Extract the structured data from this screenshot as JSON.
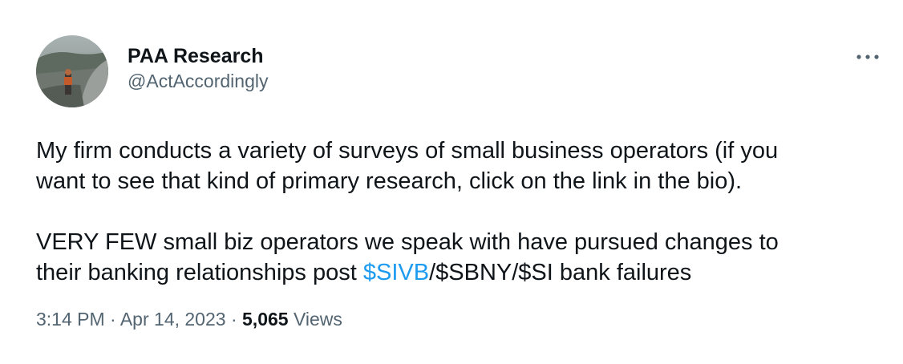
{
  "tweet": {
    "author": {
      "display_name": "PAA Research",
      "handle": "@ActAccordingly"
    },
    "more_icon": "more-horizontal-icon",
    "paragraphs": [
      {
        "line1": "My firm conducts a variety of surveys of small business operators (if you",
        "line2": "want to see that kind of primary research, click on the link in the bio)."
      },
      {
        "line1": "VERY FEW small biz operators we speak with have pursued changes to",
        "line2_prefix": "their banking relationships post ",
        "cashtag": "$SIVB",
        "line2_suffix": "/$SBNY/$SI bank failures"
      }
    ],
    "meta": {
      "time": "3:14 PM",
      "separator": "·",
      "date": "Apr 14, 2023",
      "views_count": "5,065",
      "views_label": "Views"
    },
    "colors": {
      "text": "#0f1419",
      "secondary": "#536471",
      "link": "#1d9bf0"
    }
  }
}
